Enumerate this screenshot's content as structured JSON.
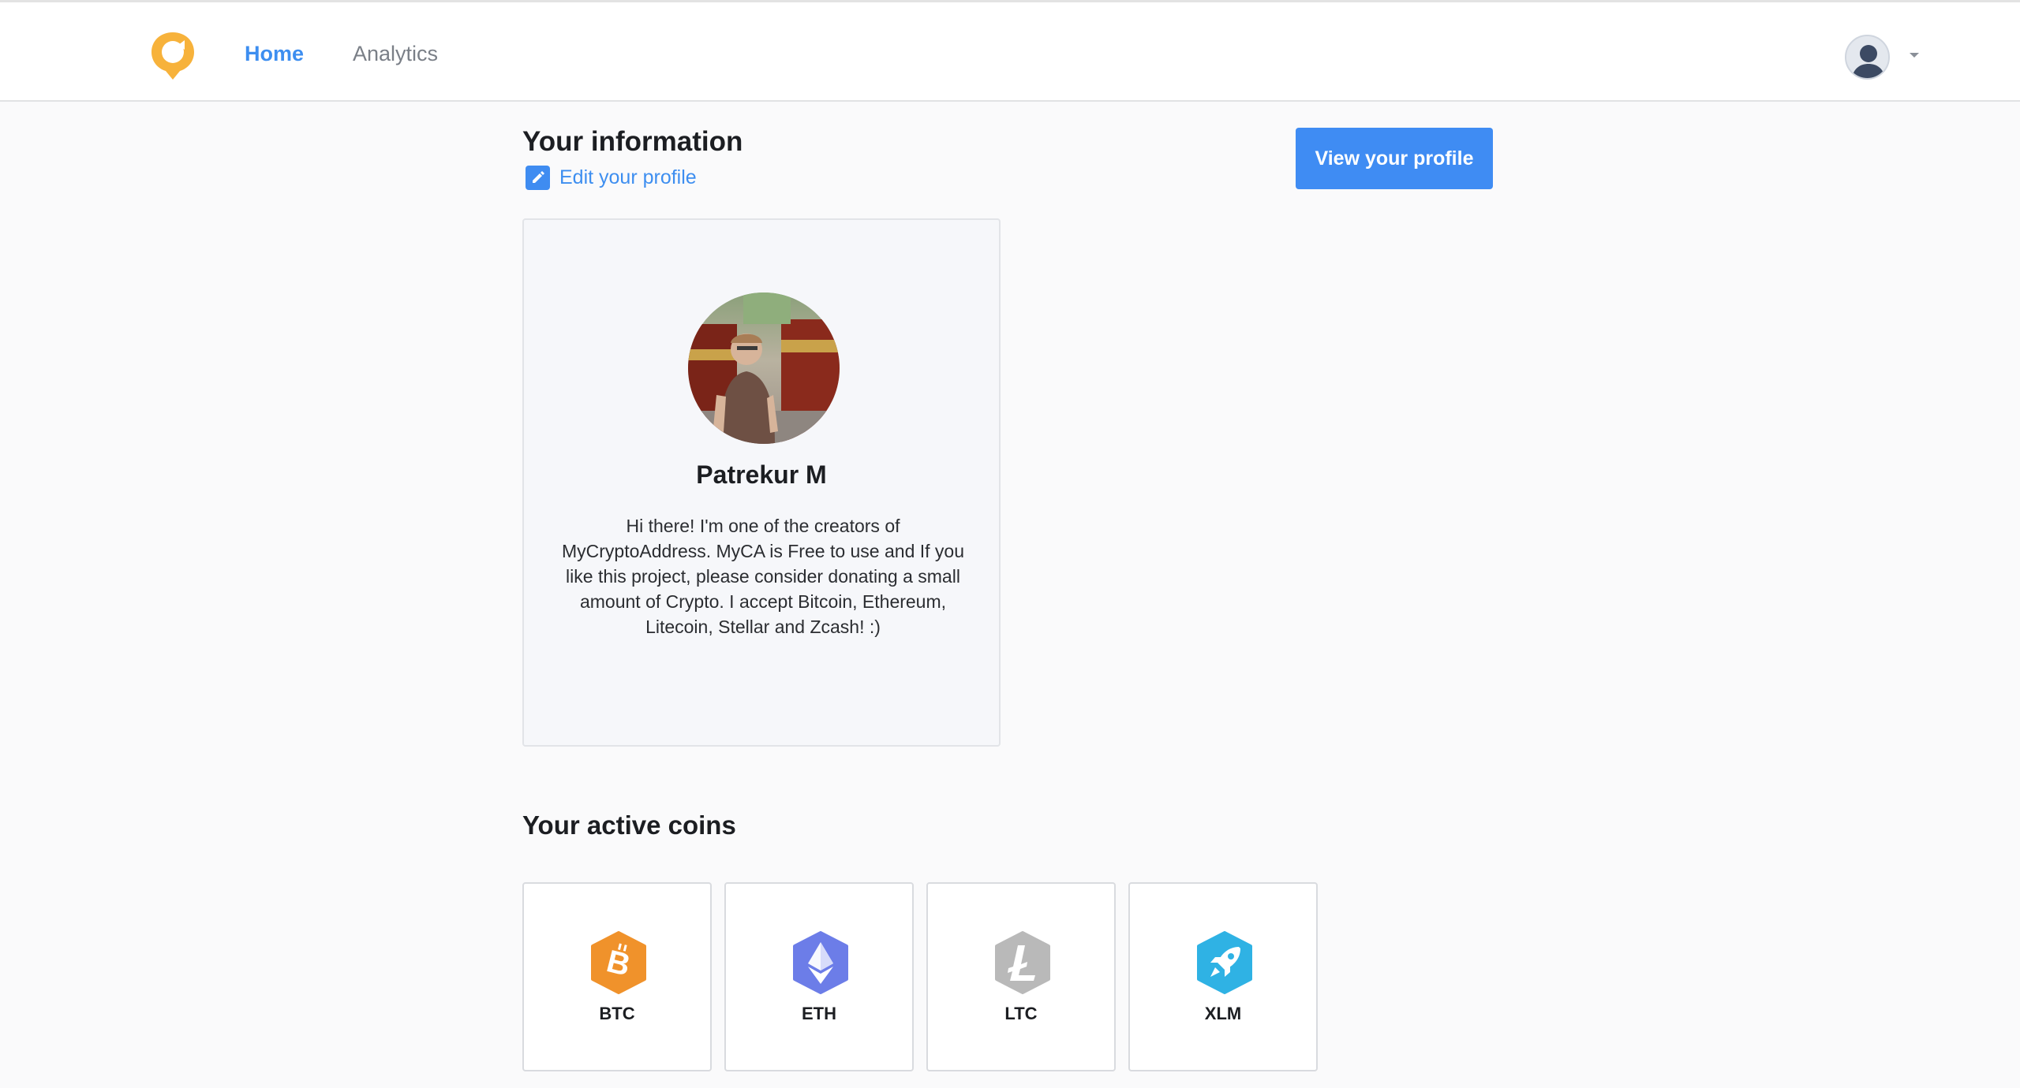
{
  "nav": {
    "home": "Home",
    "analytics": "Analytics"
  },
  "header": {
    "title": "Your information",
    "edit_link": "Edit your profile",
    "view_button": "View your profile"
  },
  "profile": {
    "name": "Patrekur M",
    "bio": "Hi there! I'm one of the creators of MyCryptoAddress. MyCA is Free to use and If you like this project, please consider donating a small amount of Crypto. I accept Bitcoin, Ethereum, Litecoin, Stellar and Zcash! :)"
  },
  "coins": {
    "title": "Your active coins",
    "items": [
      {
        "symbol": "BTC",
        "icon": "bitcoin-icon",
        "color": "#f0922b"
      },
      {
        "symbol": "ETH",
        "icon": "ethereum-icon",
        "color": "#6c7de8"
      },
      {
        "symbol": "LTC",
        "icon": "litecoin-icon",
        "color": "#b9b9b9"
      },
      {
        "symbol": "XLM",
        "icon": "stellar-icon",
        "color": "#2fb2e4"
      }
    ]
  },
  "colors": {
    "accent": "#3f8cf3",
    "logo": "#f7b23b",
    "background": "#fafafb"
  }
}
